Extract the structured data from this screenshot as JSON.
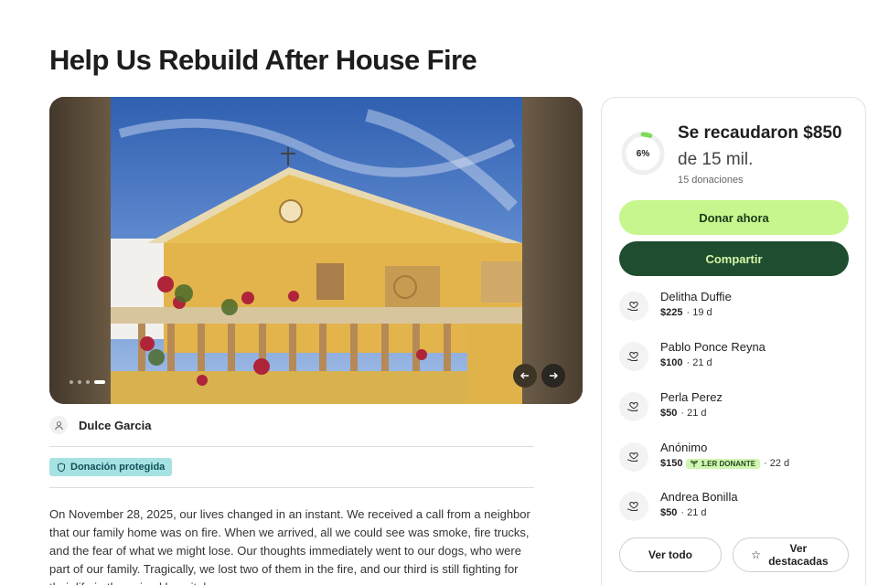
{
  "page": {
    "title": "Help Us Rebuild After House Fire"
  },
  "gallery": {
    "slides": 4,
    "active_slide": 4,
    "prev_icon": "arrow-left-icon",
    "next_icon": "arrow-right-icon"
  },
  "organizer": {
    "name": "Dulce Garcia"
  },
  "badge": {
    "label": "Donación protegida"
  },
  "story": {
    "text": "On November 28, 2025, our lives changed in an instant. We received a call from a neighbor that our family home was on fire. When we arrived, all we could see was smoke, fire trucks, and the fear of what we might lose. Our thoughts immediately went to our dogs, who were part of our family. Tragically, we lost two of them in the fire, and our third is still fighting for their life in the animal hospital."
  },
  "progress": {
    "percent_label": "6%",
    "percent": 6,
    "raised": "Se recaudaron $850",
    "goal": "de 15 mil.",
    "count": "15 donaciones"
  },
  "actions": {
    "donate": "Donar ahora",
    "share": "Compartir"
  },
  "donations": [
    {
      "name": "Delitha Duffie",
      "amount": "$225",
      "time": "· 19 d",
      "badge": ""
    },
    {
      "name": "Pablo Ponce Reyna",
      "amount": "$100",
      "time": "· 21 d",
      "badge": ""
    },
    {
      "name": "Perla Perez",
      "amount": "$50",
      "time": "· 21 d",
      "badge": ""
    },
    {
      "name": "Anónimo",
      "amount": "$150",
      "time": "· 22 d",
      "badge": "1.ER DONANTE"
    },
    {
      "name": "Andrea Bonilla",
      "amount": "$50",
      "time": "· 21 d",
      "badge": ""
    }
  ],
  "footer": {
    "see_all": "Ver todo",
    "see_featured": "Ver destacadas"
  },
  "colors": {
    "donate_bg": "#c6f68d",
    "share_bg": "#1e4d30",
    "badge_bg": "#a7e2e3",
    "ring": "#7ddc5a"
  }
}
